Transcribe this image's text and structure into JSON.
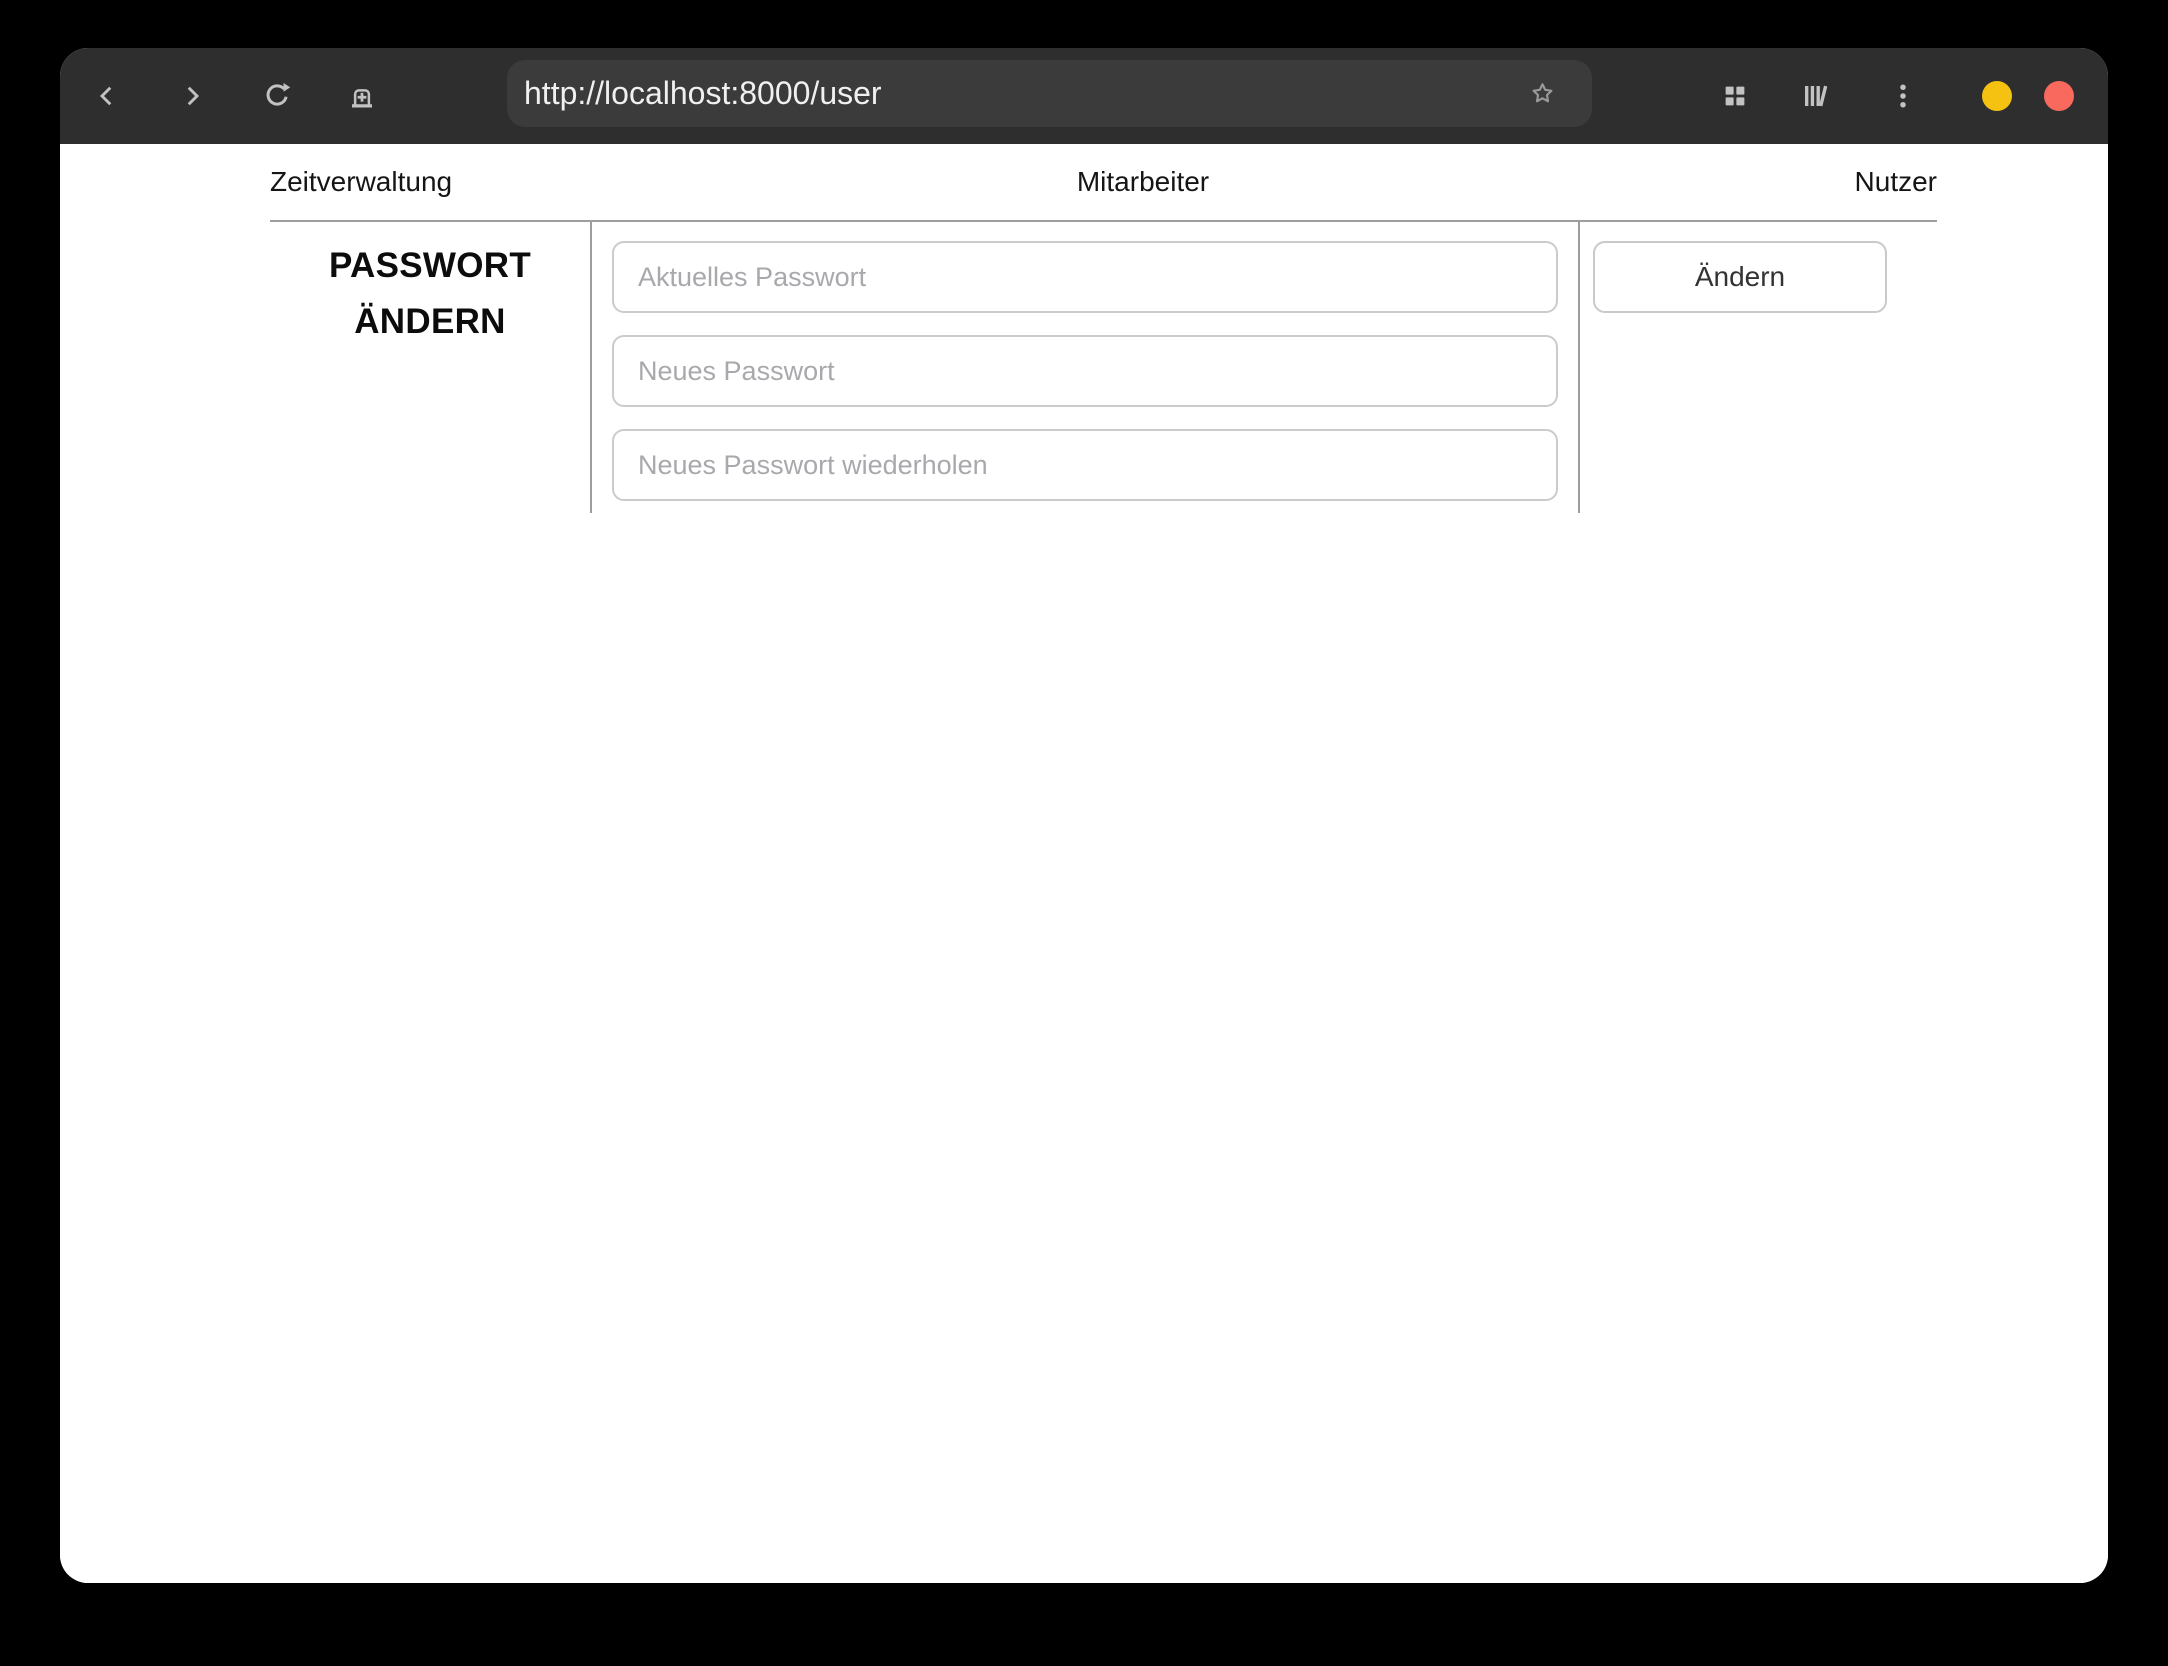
{
  "browser": {
    "url_field": {
      "value": "http://localhost:8000/user"
    },
    "window_controls": {
      "minimize_color": "#f5c211",
      "close_color": "#f9695e"
    }
  },
  "page": {
    "nav": {
      "items": [
        {
          "label": "Zeitverwaltung"
        },
        {
          "label": "Mitarbeiter"
        },
        {
          "label": "Nutzer"
        }
      ]
    },
    "password_section": {
      "title": "PASSWORT ÄNDERN",
      "fields": [
        {
          "placeholder": "Aktuelles Passwort",
          "value": ""
        },
        {
          "placeholder": "Neues Passwort",
          "value": ""
        },
        {
          "placeholder": "Neues Passwort wiederholen",
          "value": ""
        }
      ],
      "submit_label": "Ändern"
    }
  },
  "icons": {
    "back": "chevron-left",
    "forward": "chevron-right",
    "reload": "refresh-circular-arrow",
    "new_tab": "tab-with-plus",
    "bookmark": "star-outline",
    "tab_overview": "grid-four-squares",
    "library": "books-on-shelf",
    "menu": "kebab-three-dots",
    "minimize": "yellow-circle",
    "close": "red-circle"
  },
  "colors": {
    "titlebar_bg": "#2e2e2e",
    "urlbar_bg": "#3b3b3b",
    "icon_gray": "#c2c2c2",
    "table_border": "#9e9e9e",
    "input_border": "#cbcbcb",
    "placeholder": "#a8a8ad",
    "page_bg": "#ffffff",
    "outer_bg": "#000000"
  }
}
